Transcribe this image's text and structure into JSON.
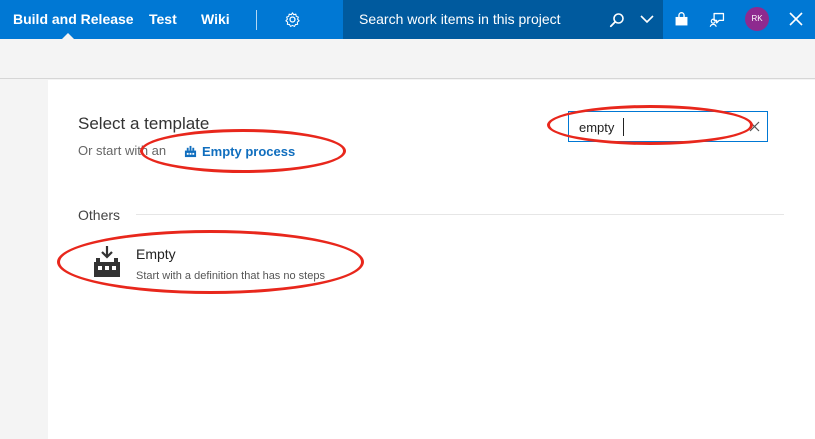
{
  "header": {
    "nav": [
      "Build and Release",
      "Test",
      "Wiki"
    ],
    "search_placeholder": "Search work items in this project",
    "avatar_initials": "RK"
  },
  "content": {
    "title": "Select a template",
    "subtitle": "Or start with an",
    "empty_process_label": "Empty process",
    "filter_value": "empty",
    "section_label": "Others",
    "templates": [
      {
        "name": "Empty",
        "description": "Start with a definition that has no steps"
      }
    ]
  },
  "colors": {
    "header_bg": "#0078d4",
    "search_bg": "#005a9e",
    "link": "#106ebe",
    "annotation": "#e8271c",
    "avatar": "#8e2a8f"
  },
  "icons": [
    "gear-icon",
    "search-icon",
    "chevron-down-icon",
    "shopping-bag-icon",
    "feedback-icon",
    "close-icon",
    "build-icon",
    "clear-icon"
  ]
}
